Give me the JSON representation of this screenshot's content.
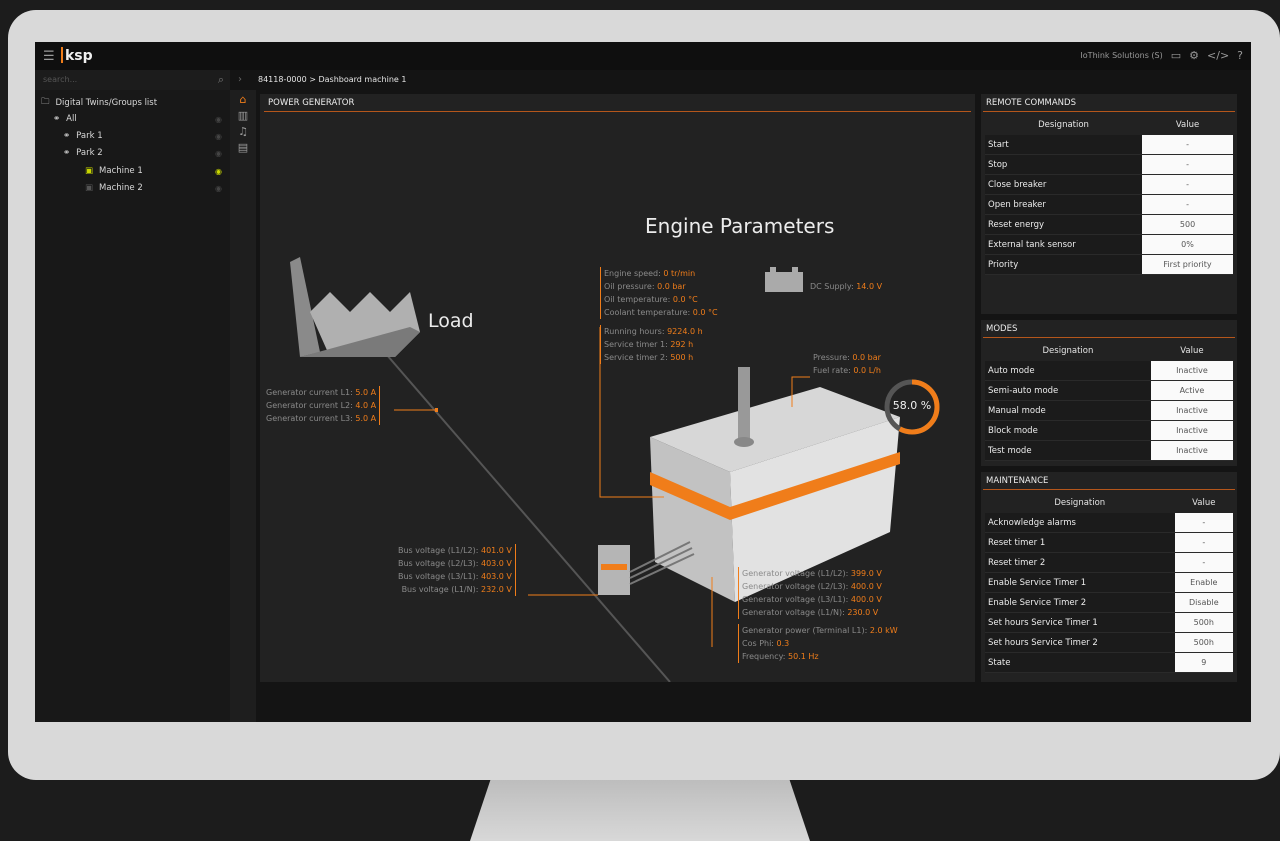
{
  "app": {
    "brand": "ksp",
    "account": "IoThink Solutions (S)",
    "search_placeholder": "search...",
    "breadcrumb": "84118-0000 > Dashboard machine 1"
  },
  "sidebar": {
    "header": "Digital Twins/Groups list",
    "items": [
      {
        "label": "All"
      },
      {
        "label": "Park 1"
      },
      {
        "label": "Park 2"
      },
      {
        "label": "Machine 1"
      },
      {
        "label": "Machine 2"
      }
    ]
  },
  "main": {
    "title": "POWER GENERATOR",
    "engine_title": "Engine Parameters",
    "load_title": "Load",
    "gauge": {
      "value": 58.0,
      "text": "58.0 %"
    },
    "engine_params": [
      {
        "label": "Engine speed: ",
        "value": "0 tr/min"
      },
      {
        "label": "Oil pressure: ",
        "value": "0.0 bar"
      },
      {
        "label": "Oil temperature: ",
        "value": "0.0 °C"
      },
      {
        "label": "Coolant temperature: ",
        "value": "0.0 °C"
      }
    ],
    "service_params": [
      {
        "label": "Running hours: ",
        "value": "9224.0 h"
      },
      {
        "label": "Service timer 1: ",
        "value": "292 h"
      },
      {
        "label": "Service timer 2: ",
        "value": "500 h"
      }
    ],
    "dc_supply": {
      "label": "DC Supply: ",
      "value": "14.0 V"
    },
    "fuel_params": [
      {
        "label": "Pressure: ",
        "value": "0.0 bar"
      },
      {
        "label": "Fuel rate: ",
        "value": "0.0 L/h"
      }
    ],
    "current_params": [
      {
        "label": "Generator current L1: ",
        "value": "5.0 A"
      },
      {
        "label": "Generator current L2: ",
        "value": "4.0 A"
      },
      {
        "label": "Generator current L3: ",
        "value": "5.0 A"
      }
    ],
    "bus_params": [
      {
        "label": "Bus voltage (L1/L2): ",
        "value": "401.0 V"
      },
      {
        "label": "Bus voltage (L2/L3): ",
        "value": "403.0 V"
      },
      {
        "label": "Bus voltage (L3/L1): ",
        "value": "403.0 V"
      },
      {
        "label": "Bus voltage (L1/N): ",
        "value": "232.0 V"
      }
    ],
    "gen_voltage_params": [
      {
        "label": "Generator voltage (L1/L2): ",
        "value": "399.0 V"
      },
      {
        "label": "Generator voltage (L2/L3): ",
        "value": "400.0 V"
      },
      {
        "label": "Generator voltage (L3/L1): ",
        "value": "400.0 V"
      },
      {
        "label": "Generator voltage (L1/N): ",
        "value": "230.0 V"
      }
    ],
    "power_params": [
      {
        "label": "Generator power (Terminal L1): ",
        "value": "2.0 kW"
      },
      {
        "label": "Cos Phi: ",
        "value": "0.3"
      },
      {
        "label": "Frequency: ",
        "value": "50.1 Hz"
      }
    ]
  },
  "remote_commands": {
    "title": "REMOTE COMMANDS",
    "col_designation": "Designation",
    "col_value": "Value",
    "rows": [
      {
        "label": "Start",
        "value": "-"
      },
      {
        "label": "Stop",
        "value": "-"
      },
      {
        "label": "Close breaker",
        "value": "-"
      },
      {
        "label": "Open breaker",
        "value": "-"
      },
      {
        "label": "Reset energy",
        "value": "500"
      },
      {
        "label": "External tank sensor",
        "value": "0%"
      },
      {
        "label": "Priority",
        "value": "First priority"
      }
    ]
  },
  "modes": {
    "title": "MODES",
    "col_designation": "Designation",
    "col_value": "Value",
    "rows": [
      {
        "label": "Auto mode",
        "value": "Inactive"
      },
      {
        "label": "Semi-auto mode",
        "value": "Active"
      },
      {
        "label": "Manual mode",
        "value": "Inactive"
      },
      {
        "label": "Block mode",
        "value": "Inactive"
      },
      {
        "label": "Test mode",
        "value": "Inactive"
      }
    ]
  },
  "maintenance": {
    "title": "MAINTENANCE",
    "col_designation": "Designation",
    "col_value": "Value",
    "rows": [
      {
        "label": "Acknowledge alarms",
        "value": "-"
      },
      {
        "label": "Reset timer 1",
        "value": "-"
      },
      {
        "label": "Reset timer 2",
        "value": "-"
      },
      {
        "label": "Enable Service Timer 1",
        "value": "Enable"
      },
      {
        "label": "Enable Service Timer 2",
        "value": "Disable"
      },
      {
        "label": "Set hours Service Timer 1",
        "value": "500h"
      },
      {
        "label": "Set hours Service Timer 2",
        "value": "500h"
      },
      {
        "label": "State",
        "value": "9"
      }
    ]
  },
  "colors": {
    "accent": "#f07d1a",
    "indicator_on": "#c8d600"
  }
}
